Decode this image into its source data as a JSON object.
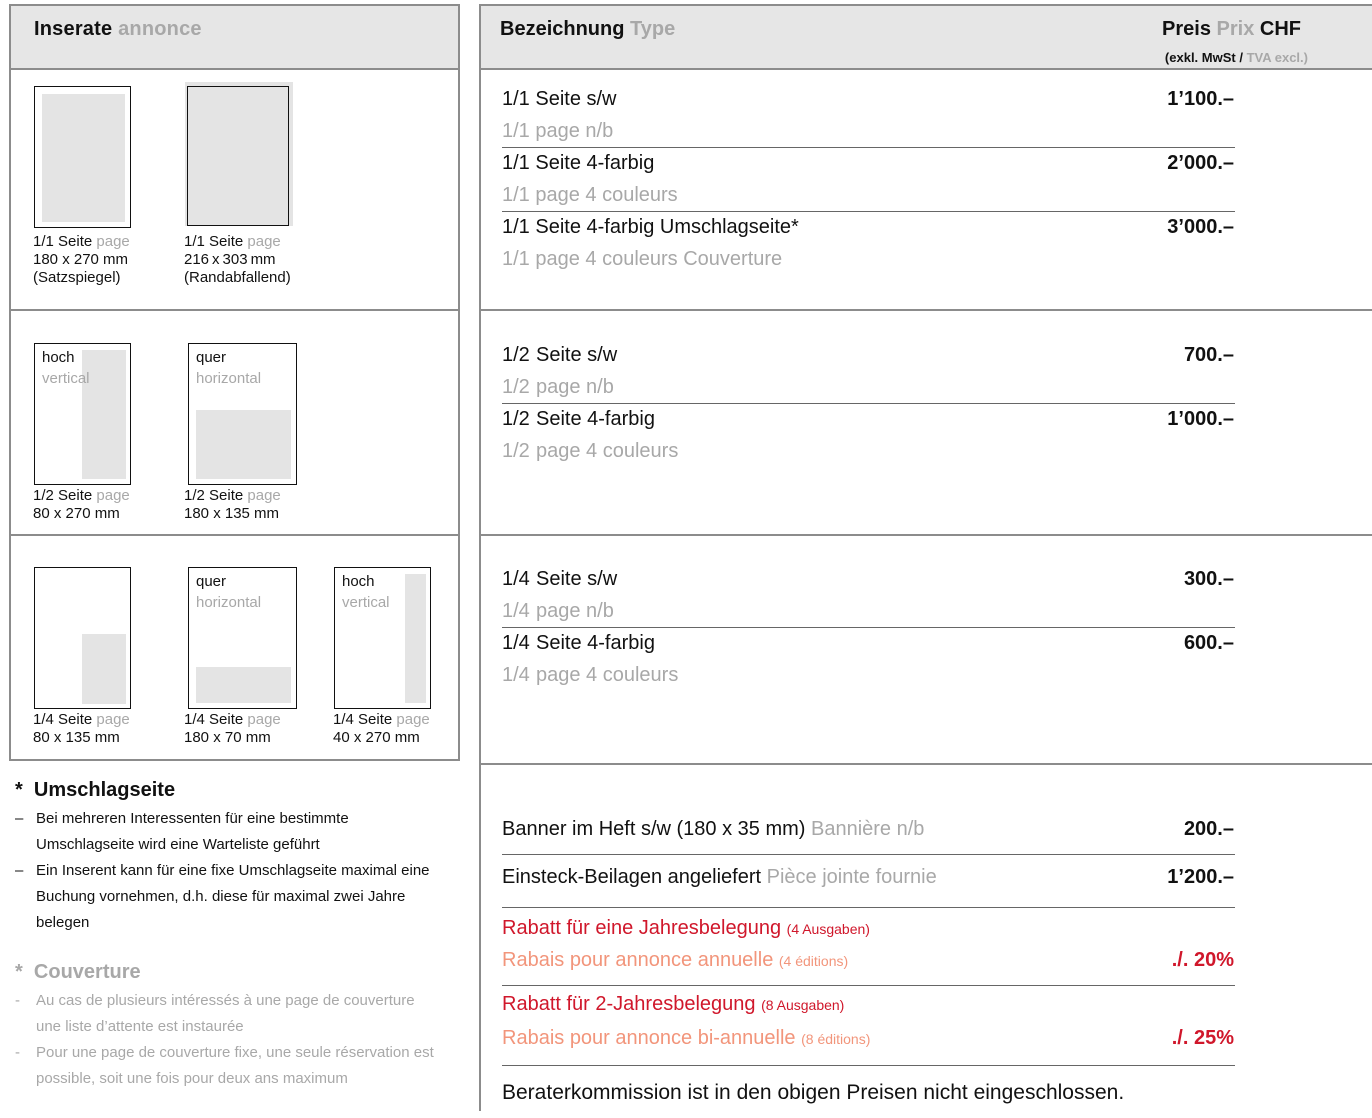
{
  "left": {
    "header": {
      "de": "Inserate",
      "fr": "annonce"
    },
    "s1": {
      "a": {
        "de": "1/1 Seite",
        "fr": "page",
        "size": "180 x 270 mm",
        "note": "(Satzspiegel)"
      },
      "b": {
        "de": "1/1 Seite",
        "fr": "page",
        "size": "216 x 303 mm",
        "note": "(Randabfallend)"
      }
    },
    "s2": {
      "a": {
        "label_de": "hoch",
        "label_fr": "vertical",
        "de": "1/2 Seite",
        "fr": "page",
        "size": "80 x 270 mm"
      },
      "b": {
        "label_de": "quer",
        "label_fr": "horizontal",
        "de": "1/2 Seite",
        "fr": "page",
        "size": "180 x 135 mm"
      }
    },
    "s3": {
      "a": {
        "de": "1/4 Seite",
        "fr": "page",
        "size": "80 x 135 mm"
      },
      "b": {
        "label_de": "quer",
        "label_fr": "horizontal",
        "de": "1/4 Seite",
        "fr": "page",
        "size": "180 x 70 mm"
      },
      "c": {
        "label_de": "hoch",
        "label_fr": "vertical",
        "de": "1/4 Seite",
        "fr": "page",
        "size": "40 x 270 mm"
      }
    }
  },
  "right": {
    "header": {
      "type_de": "Bezeichnung",
      "type_fr": "Type",
      "price_de": "Preis",
      "price_fr": "Prix",
      "currency": "CHF",
      "vat_de": "(exkl. MwSt /",
      "vat_fr": "TVA excl.)"
    },
    "full": [
      {
        "de": "1/1 Seite s/w",
        "fr": "1/1 page n/b",
        "price": "1’100.–"
      },
      {
        "de": "1/1 Seite 4-farbig",
        "fr": "1/1 page 4 couleurs",
        "price": "2’000.–"
      },
      {
        "de": "1/1 Seite 4-farbig Umschlagseite*",
        "fr": "1/1 page 4 couleurs Couverture",
        "price": "3’000.–"
      }
    ],
    "half": [
      {
        "frac": "1/2",
        "de": "Seite s/w",
        "fr": "page n/b",
        "price": "700.–"
      },
      {
        "frac": "1/2",
        "de": "Seite 4-farbig",
        "fr": "page 4 couleurs",
        "price": "1’000.–"
      }
    ],
    "quarter": [
      {
        "frac": "1/4",
        "de": "Seite s/w",
        "fr": "page n/b",
        "price": "300.–"
      },
      {
        "frac": "1/4",
        "de": "Seite 4-farbig",
        "fr": "page 4 couleurs",
        "price": "600.–"
      }
    ],
    "banner": {
      "de": "Banner im Heft s/w (180 x 35 mm)",
      "fr": "Bannière n/b",
      "price": "200.–"
    },
    "insert": {
      "de": "Einsteck-Beilagen angeliefert",
      "fr": "Pièce jointe fournie",
      "price": "1’200.–"
    },
    "annual": {
      "de": "Rabatt für eine Jahresbelegung",
      "de_small": "(4 Ausgaben)",
      "fr": "Rabais pour annonce annuelle",
      "fr_small": "(4 éditions)",
      "price": "./. 20%"
    },
    "biannual": {
      "de": "Rabatt für 2-Jahresbelegung",
      "de_small": "(8 Ausgaben)",
      "fr": "Rabais pour annonce bi-annuelle",
      "fr_small": "(8 éditions)",
      "price": "./. 25%"
    },
    "footer": "Beraterkommission ist in den obigen Preisen nicht eingeschlossen."
  },
  "notes": {
    "de_title": "Umschlagseite",
    "de_items": [
      "Bei mehreren Interessenten für eine bestimmte Umschlagseite wird eine Warteliste geführt",
      "Ein Inserent kann für eine fixe Umschlagseite maximal  eine Buchung vornehmen, d.h. diese für maximal zwei Jahre belegen"
    ],
    "fr_title": "Couverture",
    "fr_items": [
      "Au cas de plusieurs intéressés à une page de couverture une liste d’attente est instaurée",
      "Pour une page de couverture fixe, une seule réservation est possible, soit une fois pour deux ans maximum"
    ],
    "star": "*",
    "dash": "–",
    "dash_fr": "-"
  }
}
